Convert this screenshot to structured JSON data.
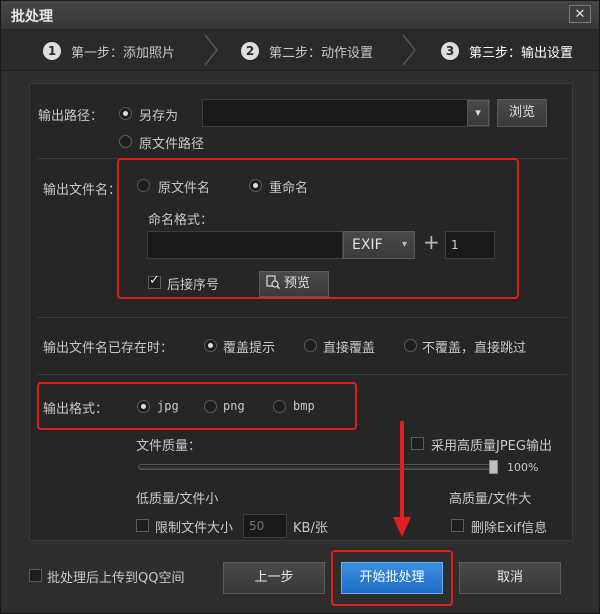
{
  "window": {
    "title": "批处理",
    "close_glyph": "✕"
  },
  "steps": [
    {
      "num": "1",
      "label": "第一步：添加照片"
    },
    {
      "num": "2",
      "label": "第二步：动作设置"
    },
    {
      "num": "3",
      "label": "第三步：输出设置"
    }
  ],
  "output_path": {
    "label": "输出路径：",
    "option_save_as": "另存为",
    "option_original": "原文件路径",
    "path_value": "",
    "browse_label": "浏览",
    "dropdown_glyph": "▾"
  },
  "file_name": {
    "label": "输出文件名：",
    "option_original": "原文件名",
    "option_rename": "重命名",
    "naming_label": "命名格式：",
    "name_value": "",
    "exif_label": "EXIF",
    "plus_glyph": "+",
    "serial_value": "1",
    "suffix_label": "后接序号",
    "preview_label": "预览"
  },
  "exists": {
    "label": "输出文件名已存在时：",
    "opt1": "覆盖提示",
    "opt2": "直接覆盖",
    "opt3": "不覆盖，直接跳过"
  },
  "format": {
    "label": "输出格式：",
    "opt_jpg": "jpg",
    "opt_png": "png",
    "opt_bmp": "bmp"
  },
  "quality": {
    "label": "文件质量：",
    "hq_jpeg_label": "采用高质量JPEG输出",
    "value": 100,
    "value_text": "100%",
    "low_label": "低质量/文件小",
    "high_label": "高质量/文件大",
    "limit_label": "限制文件大小",
    "limit_value": "50",
    "limit_unit": "KB/张",
    "delete_exif_label": "删除Exif信息"
  },
  "footer": {
    "upload_label": "批处理后上传到QQ空间",
    "prev_label": "上一步",
    "start_label": "开始批处理",
    "cancel_label": "取消"
  }
}
